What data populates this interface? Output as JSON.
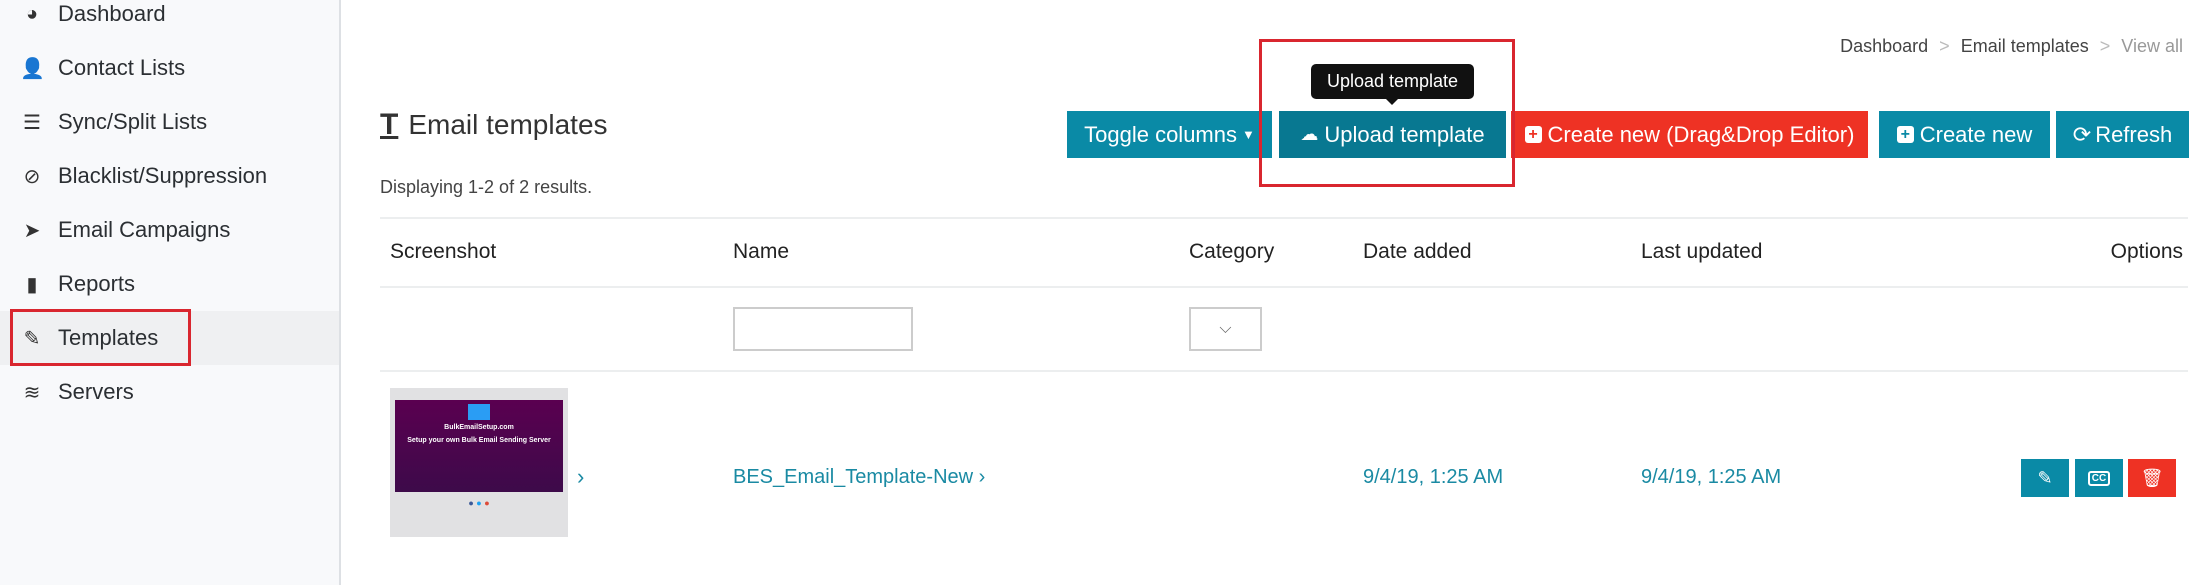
{
  "sidebar": {
    "items": [
      {
        "label": "Dashboard",
        "icon": "dashboard-icon"
      },
      {
        "label": "Contact Lists",
        "icon": "user-plus-icon"
      },
      {
        "label": "Sync/Split Lists",
        "icon": "list-ol-icon"
      },
      {
        "label": "Blacklist/Suppression",
        "icon": "ban-icon"
      },
      {
        "label": "Email Campaigns",
        "icon": "paper-plane-icon"
      },
      {
        "label": "Reports",
        "icon": "bar-chart-icon"
      },
      {
        "label": "Templates",
        "icon": "paint-brush-icon",
        "active": true
      },
      {
        "label": "Servers",
        "icon": "database-icon"
      }
    ]
  },
  "breadcrumb": {
    "items": [
      "Dashboard",
      "Email templates",
      "View all"
    ],
    "separator": ">"
  },
  "page": {
    "title": "Email templates",
    "summary": "Displaying 1-2 of 2 results."
  },
  "toolbar": {
    "toggle_columns": "Toggle columns",
    "upload_template": "Upload template",
    "create_dnd": "Create new (Drag&Drop Editor)",
    "create_new": "Create new",
    "refresh": "Refresh",
    "tooltip": "Upload template"
  },
  "table": {
    "headers": [
      "Screenshot",
      "Name",
      "Category",
      "Date added",
      "Last updated",
      "Options"
    ],
    "filters": {
      "name": "",
      "category": ""
    },
    "rows": [
      {
        "name": "BES_Email_Template-New",
        "date_added": "9/4/19, 1:25 AM",
        "last_updated": "9/4/19, 1:25 AM",
        "thumbnail": {
          "title": "BulkEmailSetup.com",
          "headline": "Setup your own Bulk Email Sending Server"
        }
      }
    ]
  },
  "colors": {
    "teal": "#0a8aa6",
    "red": "#ee3224",
    "highlight": "#d9262f"
  }
}
